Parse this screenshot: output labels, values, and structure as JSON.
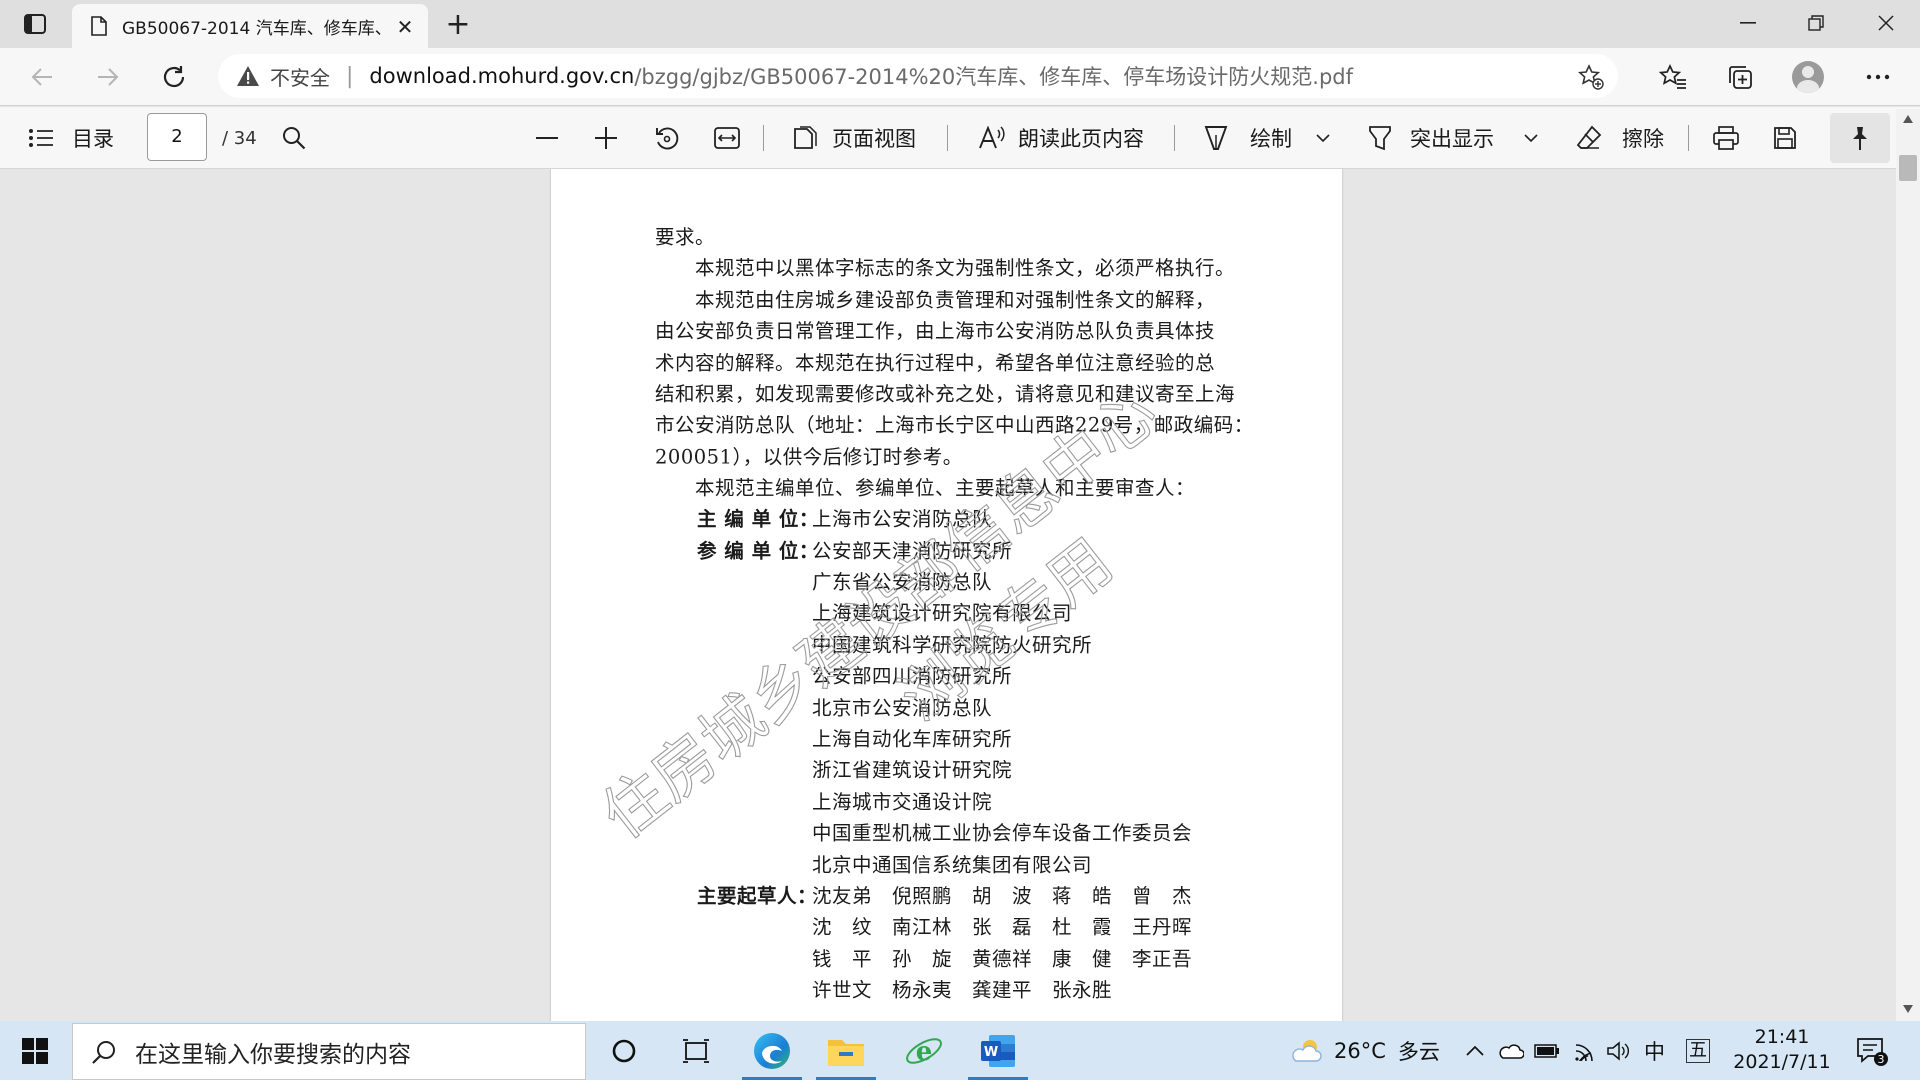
{
  "browser": {
    "tab_title": "GB50067-2014 汽车库、修车库、",
    "insecure_label": "不安全",
    "url_host": "download.mohurd.gov.cn",
    "url_path": "/bzgg/gjbz/GB50067-2014%20汽车库、修车库、停车场设计防火规范.pdf"
  },
  "pdf_toolbar": {
    "toc_label": "目录",
    "page_current": "2",
    "page_total": "/ 34",
    "page_view_label": "页面视图",
    "read_aloud_label": "朗读此页内容",
    "draw_label": "绘制",
    "highlight_label": "突出显示",
    "erase_label": "擦除"
  },
  "document": {
    "lines": [
      "要求。",
      "　　本规范中以黑体字标志的条文为强制性条文，必须严格执行。",
      "　　本规范由住房城乡建设部负责管理和对强制性条文的解释，",
      "由公安部负责日常管理工作，由上海市公安消防总队负责具体技",
      "术内容的解释。本规范在执行过程中，希望各单位注意经验的总",
      "结和积累，如发现需要修改或补充之处，请将意见和建议寄至上海",
      "市公安消防总队（地址：上海市长宁区中山西路229号，邮政编码：",
      "200051），以供今后修订时参考。",
      "　　本规范主编单位、参编单位、主要起草人和主要审查人："
    ],
    "chief_label": "主 编 单 位：",
    "chief_unit": "上海市公安消防总队",
    "partic_label": "参 编 单 位：",
    "partic_units": [
      "公安部天津消防研究所",
      "广东省公安消防总队",
      "上海建筑设计研究院有限公司",
      "中国建筑科学研究院防火研究所",
      "公安部四川消防研究所",
      "北京市公安消防总队",
      "上海自动化车库研究所",
      "浙江省建筑设计研究院",
      "上海城市交通设计院",
      "中国重型机械工业协会停车设备工作委员会",
      "北京中通国信系统集团有限公司"
    ],
    "drafters_label": "主要起草人：",
    "drafters_rows": [
      "沈友弟　倪照鹏　胡　波　蒋　皓　曾　杰",
      "沈　纹　南江林　张　磊　杜　霞　王丹晖",
      "钱　平　孙　旋　黄德祥　康　健　李正吾",
      "许世文　杨永夷　龚建平　张永胜"
    ],
    "watermark_line1": "住房城乡建设部信息中心",
    "watermark_line2": "浏览专用"
  },
  "taskbar": {
    "search_placeholder": "在这里输入你要搜索的内容",
    "weather_temp": "26°C",
    "weather_desc": "多云",
    "ime_lang": "中",
    "ime_mode": "五",
    "time": "21:41",
    "date": "2021/7/11",
    "notification_count": "3"
  },
  "colors": {
    "titlebar": "#dfdfdf",
    "toolbar": "#f7f7f7",
    "viewer_bg": "#e6e6e6",
    "taskbar": "#d6e6f4",
    "accent": "#2a7ec8"
  }
}
